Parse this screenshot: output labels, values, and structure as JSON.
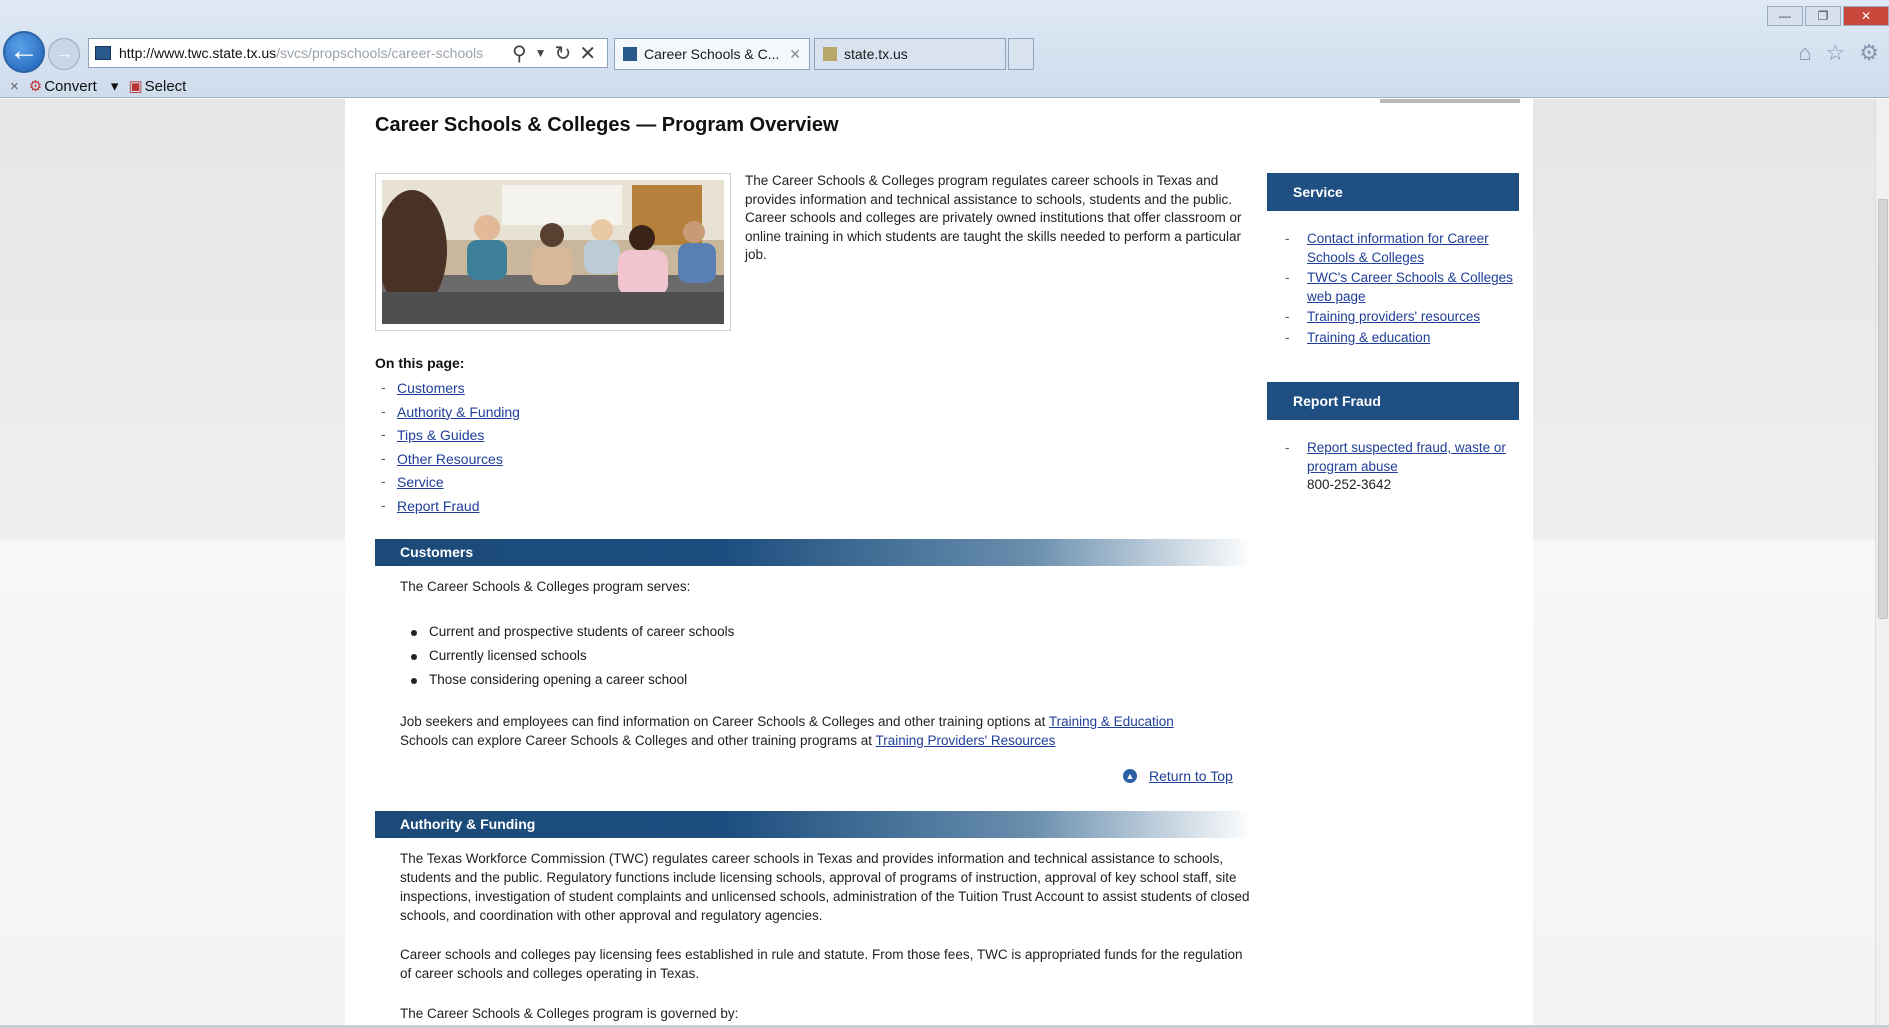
{
  "browser": {
    "url_host": "http://www.twc.state.tx.us",
    "url_path": "/svcs/propschools/career-schools",
    "tabs": [
      {
        "label": "Career Schools & C..."
      },
      {
        "label": "state.tx.us"
      }
    ],
    "cmdbar": {
      "convert": "Convert",
      "select": "Select"
    }
  },
  "page": {
    "title": "Career Schools & Colleges — Program Overview",
    "intro": "The Career Schools & Colleges program regulates career schools in Texas and provides information and technical assistance to schools, students and the public. Career schools and colleges are privately owned institutions that offer classroom or online training in which students are taught the skills needed to perform a particular job.",
    "on_this_page": {
      "heading": "On this page:",
      "links": [
        "Customers",
        "Authority & Funding",
        "Tips & Guides",
        "Other Resources",
        "Service",
        "Report Fraud"
      ]
    },
    "customers": {
      "heading": "Customers",
      "intro": "The Career Schools & Colleges program serves:",
      "items": [
        "Current and prospective students of career schools",
        "Currently licensed schools",
        "Those considering opening a career school"
      ],
      "jobs_text_1": "Job seekers and employees can find information on Career Schools & Colleges and other training options at",
      "jobs_link_1": "Training & Education",
      "jobs_text_2": "Schools can explore Career Schools & Colleges and other training programs at",
      "jobs_link_2": "Training Providers' Resources",
      "return_top": "Return to Top"
    },
    "authority": {
      "heading": "Authority & Funding",
      "p1": "The Texas Workforce Commission (TWC) regulates career schools in Texas and provides information and technical assistance to schools, students and the public. Regulatory functions include licensing schools, approval of programs of instruction, approval of key school staff, site inspections, investigation of student complaints and unlicensed schools, administration of the Tuition Trust Account to assist students of closed schools, and coordination with other approval and regulatory agencies.",
      "p2": "Career schools and colleges pay licensing fees established in rule and statute. From those fees, TWC is appropriated funds for the regulation of career schools and colleges operating in Texas.",
      "p3": "The Career Schools & Colleges program is governed by:"
    },
    "sidebar": {
      "service": {
        "heading": "Service",
        "links": [
          "Contact information for Career Schools & Colleges",
          "TWC's Career Schools & Colleges web page",
          "Training providers' resources",
          "Training & education"
        ]
      },
      "fraud": {
        "heading": "Report Fraud",
        "link": "Report suspected fraud, waste or program abuse",
        "phone": "800-252-3642"
      }
    }
  }
}
